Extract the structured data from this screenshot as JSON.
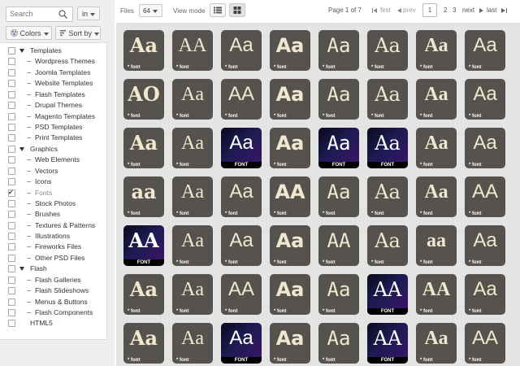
{
  "search": {
    "placeholder": "Search",
    "scope": "in"
  },
  "filters": {
    "colors": "Colors",
    "sort": "Sort by"
  },
  "tree": [
    {
      "label": "Templates",
      "level": 0,
      "checked": false
    },
    {
      "label": "Wordpress Themes",
      "level": 1,
      "checked": false
    },
    {
      "label": "Joomla Templates",
      "level": 1,
      "checked": false
    },
    {
      "label": "Website Templates",
      "level": 1,
      "checked": false
    },
    {
      "label": "Flash Templates",
      "level": 1,
      "checked": false
    },
    {
      "label": "Drupal Themes",
      "level": 1,
      "checked": false
    },
    {
      "label": "Magento Templates",
      "level": 1,
      "checked": false
    },
    {
      "label": "PSD Templates",
      "level": 1,
      "checked": false
    },
    {
      "label": "Print Templates",
      "level": 1,
      "checked": false
    },
    {
      "label": "Graphics",
      "level": 0,
      "checked": false
    },
    {
      "label": "Web Elements",
      "level": 1,
      "checked": false
    },
    {
      "label": "Vectors",
      "level": 1,
      "checked": false
    },
    {
      "label": "Icons",
      "level": 1,
      "checked": false
    },
    {
      "label": "Fonts",
      "level": 1,
      "checked": true
    },
    {
      "label": "Stock Photos",
      "level": 1,
      "checked": false
    },
    {
      "label": "Brushes",
      "level": 1,
      "checked": false
    },
    {
      "label": "Textures & Patterns",
      "level": 1,
      "checked": false
    },
    {
      "label": "Illustrations",
      "level": 1,
      "checked": false
    },
    {
      "label": "Fireworks Files",
      "level": 1,
      "checked": false
    },
    {
      "label": "Other PSD Files",
      "level": 1,
      "checked": false
    },
    {
      "label": "Flash",
      "level": 0,
      "checked": false
    },
    {
      "label": "Flash Galleries",
      "level": 1,
      "checked": false
    },
    {
      "label": "Flash Slideshows",
      "level": 1,
      "checked": false
    },
    {
      "label": "Menus & Buttons",
      "level": 1,
      "checked": false
    },
    {
      "label": "Flash Components",
      "level": 1,
      "checked": false
    },
    {
      "label": "HTML5",
      "level": 2,
      "checked": false
    }
  ],
  "topbar": {
    "files_label": "Files",
    "files_count": "64",
    "view_mode_label": "View mode",
    "page_info": "Page 1 of 7",
    "first": "first",
    "prev": "prev",
    "pages": [
      "1",
      "2",
      "3"
    ],
    "next": "next",
    "last": "last"
  },
  "caption_font": "* font",
  "caption_dark": "FONT",
  "colors": {
    "tile": "#56524d",
    "sample": "#f0e7cf",
    "grid_bg": "#e4e4e4",
    "sidebar_bg": "#eeeeee"
  },
  "tiles": [
    {
      "text": "Aa",
      "dark": false
    },
    {
      "text": "AA",
      "dark": false
    },
    {
      "text": "Aa",
      "dark": false
    },
    {
      "text": "Aa",
      "dark": false
    },
    {
      "text": "Aa",
      "dark": false
    },
    {
      "text": "Aa",
      "dark": false
    },
    {
      "text": "Aa",
      "dark": false
    },
    {
      "text": "Aa",
      "dark": false
    },
    {
      "text": "AO",
      "dark": false
    },
    {
      "text": "Aa",
      "dark": false
    },
    {
      "text": "AA",
      "dark": false
    },
    {
      "text": "Aa",
      "dark": false
    },
    {
      "text": "Aa",
      "dark": false
    },
    {
      "text": "Aa",
      "dark": false
    },
    {
      "text": "Aa",
      "dark": false
    },
    {
      "text": "Aa",
      "dark": false
    },
    {
      "text": "Aa",
      "dark": false
    },
    {
      "text": "Aa",
      "dark": false
    },
    {
      "text": "Aa",
      "dark": true
    },
    {
      "text": "Aa",
      "dark": false
    },
    {
      "text": "Aa",
      "dark": true
    },
    {
      "text": "Aa",
      "dark": true
    },
    {
      "text": "Aa",
      "dark": false
    },
    {
      "text": "Aa",
      "dark": false
    },
    {
      "text": "aa",
      "dark": false
    },
    {
      "text": "Aa",
      "dark": false
    },
    {
      "text": "Aa",
      "dark": false
    },
    {
      "text": "AA",
      "dark": false
    },
    {
      "text": "Aa",
      "dark": false
    },
    {
      "text": "Aa",
      "dark": false
    },
    {
      "text": "Aa",
      "dark": false
    },
    {
      "text": "AA",
      "dark": false
    },
    {
      "text": "AA",
      "dark": true
    },
    {
      "text": "Aa",
      "dark": false
    },
    {
      "text": "Aa",
      "dark": false
    },
    {
      "text": "Aa",
      "dark": false
    },
    {
      "text": "AA",
      "dark": false
    },
    {
      "text": "Aa",
      "dark": false
    },
    {
      "text": "aa",
      "dark": false
    },
    {
      "text": "Aa",
      "dark": false
    },
    {
      "text": "Aa",
      "dark": false
    },
    {
      "text": "Aa",
      "dark": false
    },
    {
      "text": "AA",
      "dark": false
    },
    {
      "text": "Aa",
      "dark": false
    },
    {
      "text": "Aa",
      "dark": false
    },
    {
      "text": "AA",
      "dark": true
    },
    {
      "text": "AA",
      "dark": false
    },
    {
      "text": "Aa",
      "dark": false
    },
    {
      "text": "Aa",
      "dark": false
    },
    {
      "text": "Aa",
      "dark": false
    },
    {
      "text": "Aa",
      "dark": true
    },
    {
      "text": "Aa",
      "dark": false
    },
    {
      "text": "Aa",
      "dark": false
    },
    {
      "text": "AA",
      "dark": true
    },
    {
      "text": "Aa",
      "dark": false
    },
    {
      "text": "AA",
      "dark": false
    }
  ]
}
